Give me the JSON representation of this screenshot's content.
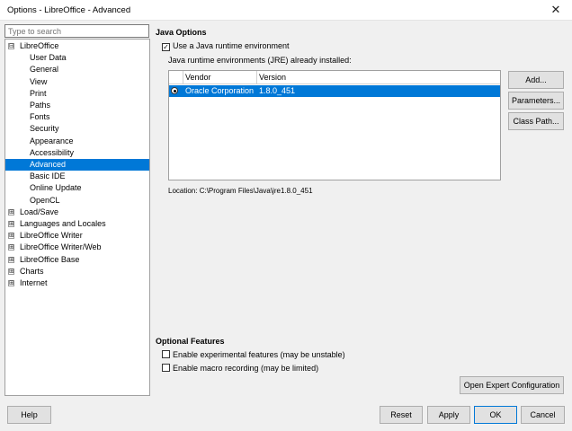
{
  "window": {
    "title": "Options - LibreOffice - Advanced",
    "close_glyph": "✕"
  },
  "search": {
    "placeholder": "Type to search"
  },
  "tree": [
    {
      "label": "LibreOffice",
      "expander": "⊟"
    },
    {
      "label": "User Data"
    },
    {
      "label": "General"
    },
    {
      "label": "View"
    },
    {
      "label": "Print"
    },
    {
      "label": "Paths"
    },
    {
      "label": "Fonts"
    },
    {
      "label": "Security"
    },
    {
      "label": "Appearance"
    },
    {
      "label": "Accessibility"
    },
    {
      "label": "Advanced",
      "selected": true
    },
    {
      "label": "Basic IDE"
    },
    {
      "label": "Online Update"
    },
    {
      "label": "OpenCL"
    },
    {
      "label": "Load/Save",
      "expander": "⊞"
    },
    {
      "label": "Languages and Locales",
      "expander": "⊞"
    },
    {
      "label": "LibreOffice Writer",
      "expander": "⊞"
    },
    {
      "label": "LibreOffice Writer/Web",
      "expander": "⊞"
    },
    {
      "label": "LibreOffice Base",
      "expander": "⊞"
    },
    {
      "label": "Charts",
      "expander": "⊞"
    },
    {
      "label": "Internet",
      "expander": "⊞"
    }
  ],
  "java": {
    "heading": "Java Options",
    "use_jre_label": "Use a Java runtime environment",
    "use_jre_checked": true,
    "check_glyph": "✓",
    "installed_label": "Java runtime environments (JRE) already installed:",
    "columns": [
      "Vendor",
      "Version"
    ],
    "rows": [
      {
        "vendor": "Oracle Corporation",
        "version": "1.8.0_451",
        "selected": true
      }
    ],
    "location": "Location: C:\\Program Files\\Java\\jre1.8.0_451",
    "add_label": "Add...",
    "parameters_label": "Parameters...",
    "classpath_label": "Class Path..."
  },
  "optional": {
    "heading": "Optional Features",
    "experimental_label": "Enable experimental features (may be unstable)",
    "experimental_checked": false,
    "macro_label": "Enable macro recording (may be limited)",
    "macro_checked": false,
    "expert_label": "Open Expert Configuration"
  },
  "footer": {
    "help_label": "Help",
    "reset_label": "Reset",
    "apply_label": "Apply",
    "ok_label": "OK",
    "cancel_label": "Cancel"
  },
  "colors": {
    "selection": "#0078d7",
    "background": "#f0f0f0"
  }
}
